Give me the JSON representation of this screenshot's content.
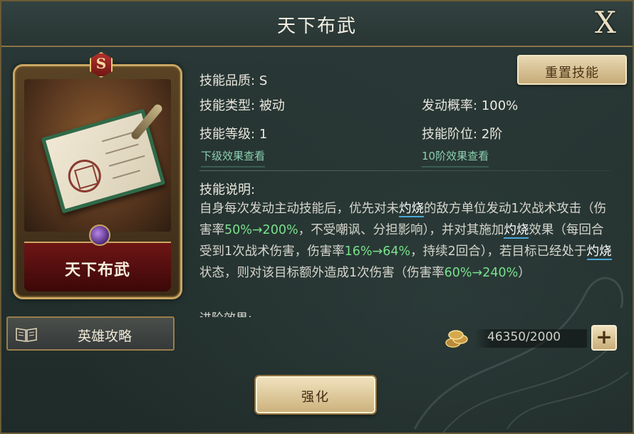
{
  "window": {
    "title": "天下布武"
  },
  "card": {
    "grade": "S",
    "name": "天下布武",
    "icon": "skill-scroll-icon"
  },
  "guide_button": {
    "label": "英雄攻略",
    "icon": "book-icon"
  },
  "reset_button": {
    "label": "重置技能"
  },
  "attributes": {
    "quality_label": "技能品质:",
    "quality_value": "S",
    "type_label": "技能类型:",
    "type_value": "被动",
    "rate_label": "发动概率:",
    "rate_value": "100%",
    "level_label": "技能等级:",
    "level_value": "1",
    "rank_label": "技能阶位:",
    "rank_value": "2阶",
    "lower_effect_link": "下级效果查看",
    "rank10_effect_link": "10阶效果查看"
  },
  "description": {
    "title": "技能说明:",
    "segments": [
      "自身每次发动主动技能后，优先对未",
      "灼烧",
      "的敌方单位发动1次战术攻击（伤害率",
      "50%→200%",
      "，不受嘲讽、分担影响），并对其施加",
      "灼烧",
      "效果（每回合受到1次战术伤害，伤害率",
      "16%→64%",
      "，持续2回合），若目标已经处于",
      "灼烧",
      "状态，则对该目标额外造成1次伤害（伤害率",
      "60%→240%",
      "）"
    ],
    "next_section_title": "进阶效果:"
  },
  "resource": {
    "icon": "gold-coins-icon",
    "value": "46350/2000"
  },
  "strengthen_button": {
    "label": "强化"
  },
  "close_button": {
    "label": "X"
  },
  "colors": {
    "highlight_number": "#79e08c",
    "keyword_underline": "#4aa6d9",
    "gold_border": "#c9a662"
  }
}
